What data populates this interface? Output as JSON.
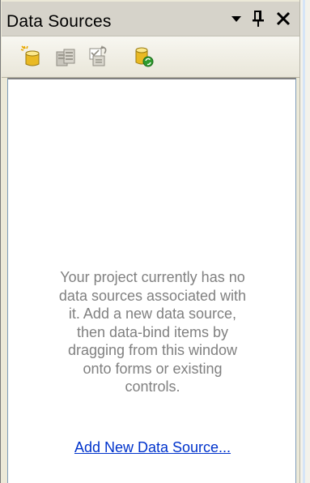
{
  "window": {
    "title": "Data Sources"
  },
  "title_buttons": {
    "dropdown_icon": "chevron-down-icon",
    "pin_icon": "pin-icon",
    "close_icon": "close-icon"
  },
  "toolbar": {
    "items": [
      {
        "icon": "add-new-data-source-icon"
      },
      {
        "icon": "edit-dataset-designer-icon"
      },
      {
        "icon": "configure-dataset-wizard-icon"
      },
      {
        "icon": "refresh-icon"
      }
    ]
  },
  "content": {
    "message": "Your project currently has no\ndata sources associated with\nit. Add a new data source,\nthen data-bind items by\ndragging from this window\nonto forms or existing\ncontrols.",
    "add_link_label": "Add New Data Source..."
  },
  "colors": {
    "link": "#0033cc",
    "message": "#808080",
    "titlebar": "#d6d3ca"
  }
}
